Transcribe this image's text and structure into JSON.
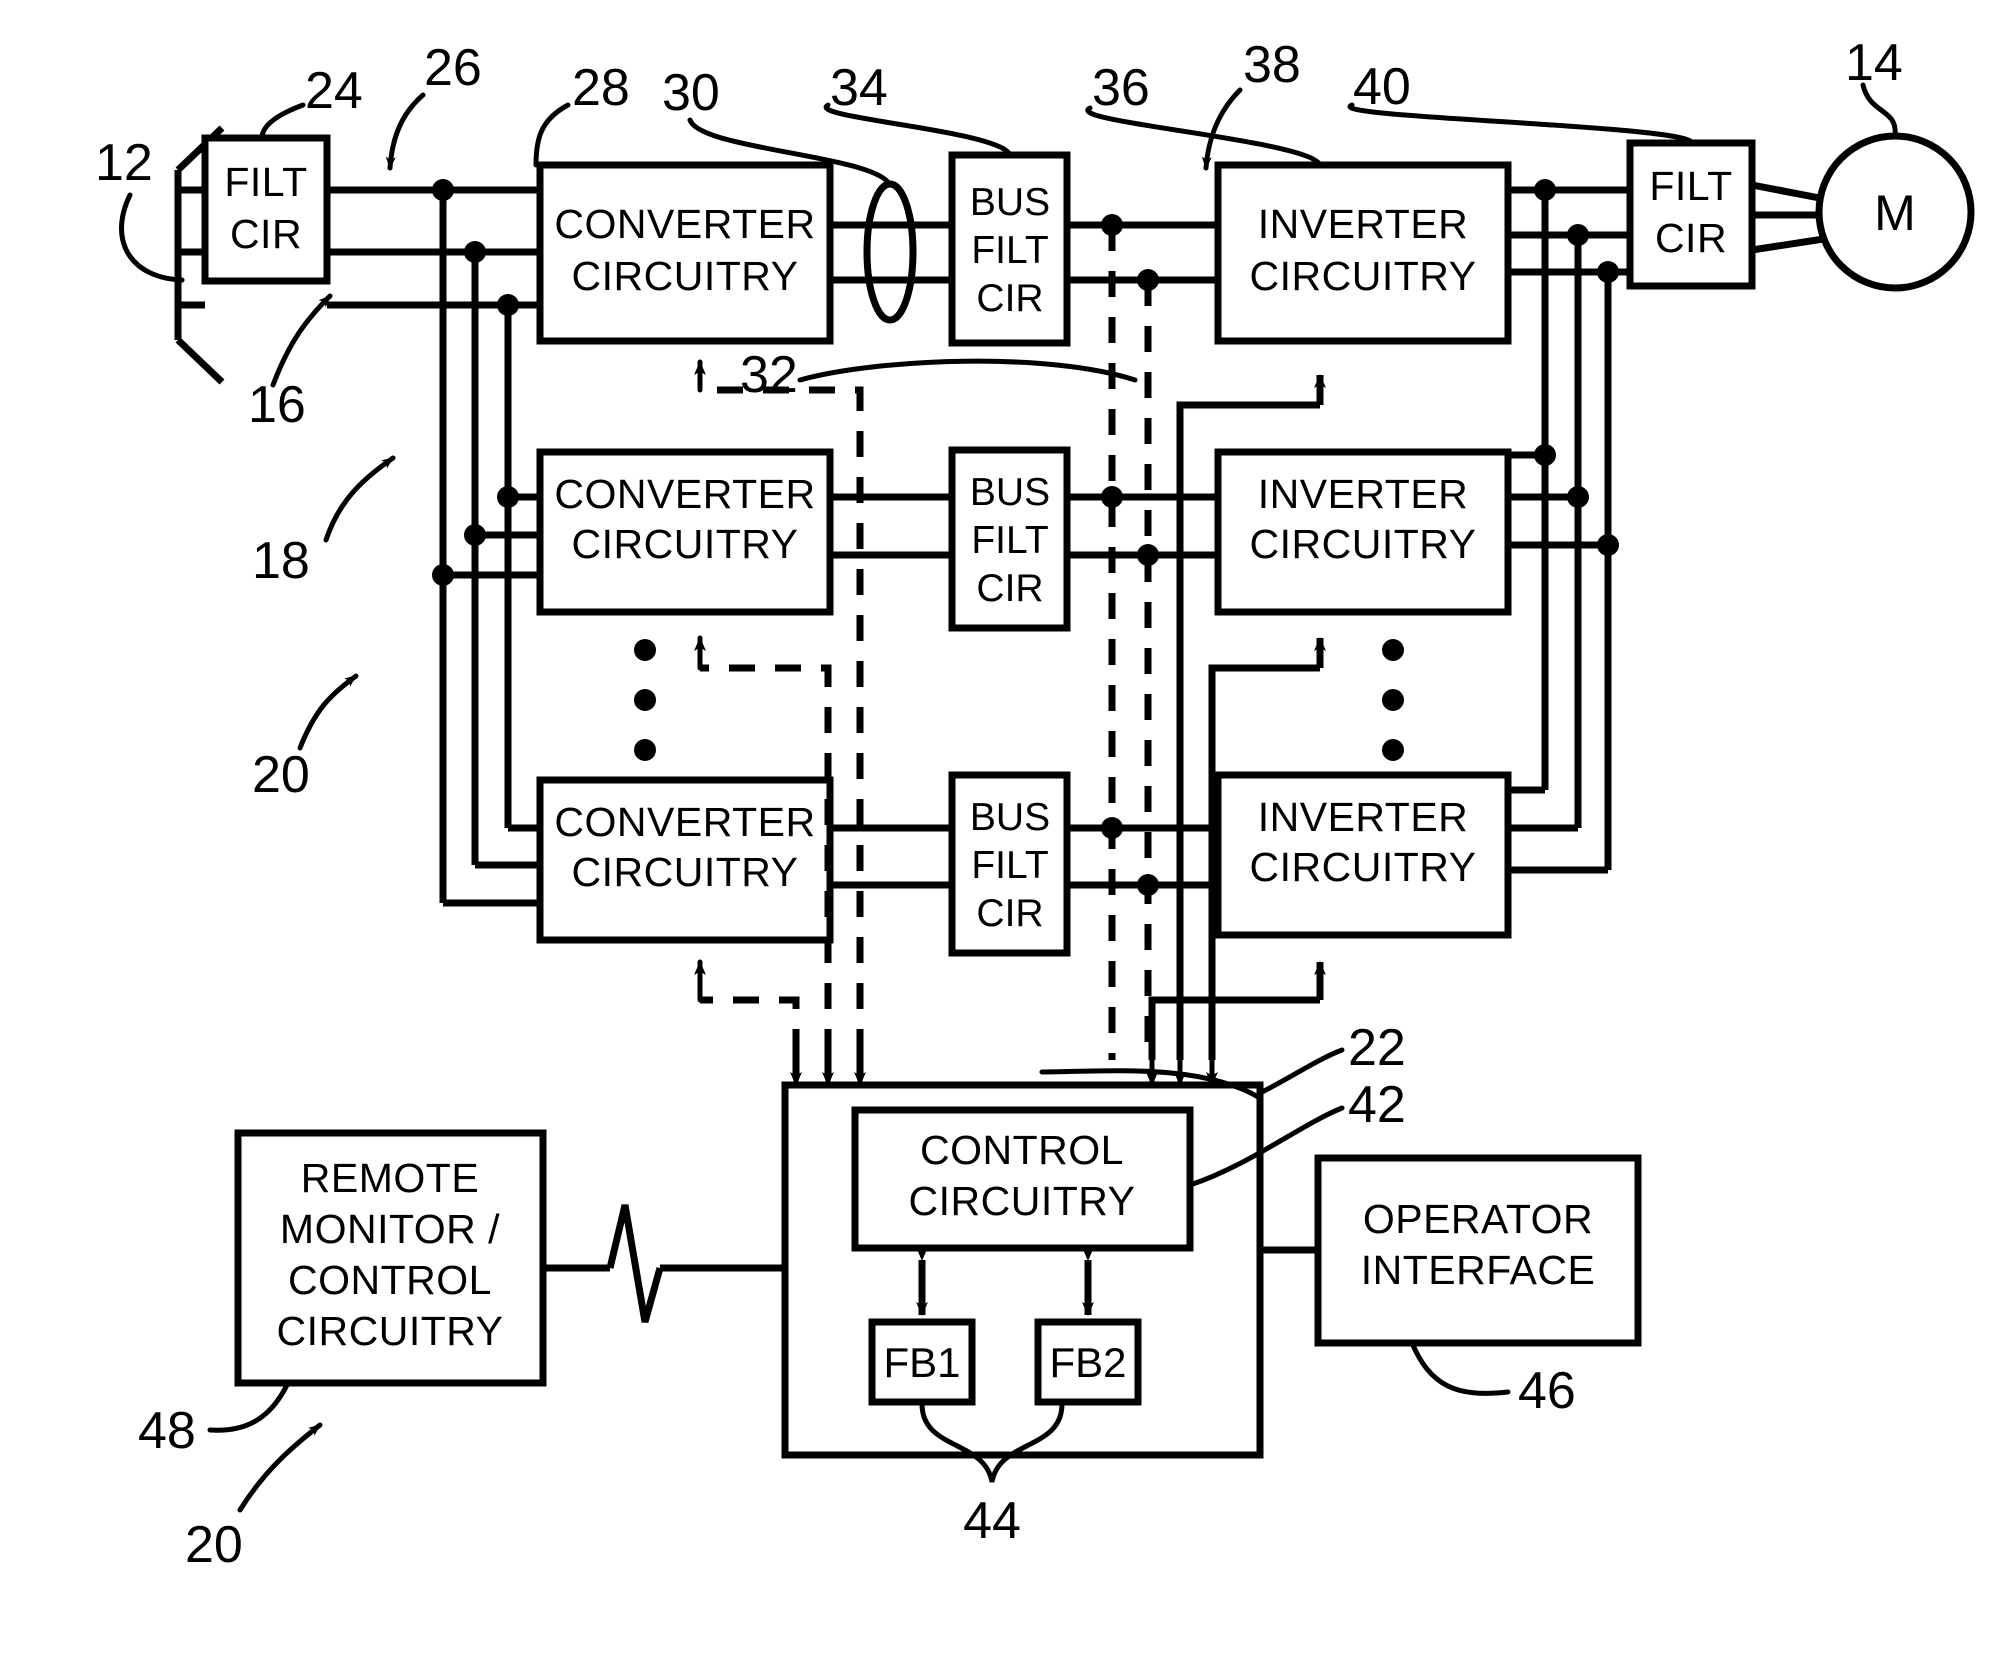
{
  "figure": {
    "type": "patent-block-diagram",
    "description": "Multi-converter / multi-inverter motor drive block diagram"
  },
  "blocks": {
    "input_filter": {
      "line1": "FILT",
      "line2": "CIR",
      "ref": "24"
    },
    "converter_1": {
      "line1": "CONVERTER",
      "line2": "CIRCUITRY",
      "ref": "28"
    },
    "converter_2": {
      "line1": "CONVERTER",
      "line2": "CIRCUITRY"
    },
    "converter_n": {
      "line1": "CONVERTER",
      "line2": "CIRCUITRY"
    },
    "bus_filter_1": {
      "line1": "BUS",
      "line2": "FILT",
      "line3": "CIR",
      "ref": "34"
    },
    "bus_filter_2": {
      "line1": "BUS",
      "line2": "FILT",
      "line3": "CIR"
    },
    "bus_filter_n": {
      "line1": "BUS",
      "line2": "FILT",
      "line3": "CIR"
    },
    "inverter_1": {
      "line1": "INVERTER",
      "line2": "CIRCUITRY",
      "ref": "36"
    },
    "inverter_2": {
      "line1": "INVERTER",
      "line2": "CIRCUITRY"
    },
    "inverter_n": {
      "line1": "INVERTER",
      "line2": "CIRCUITRY"
    },
    "output_filter": {
      "line1": "FILT",
      "line2": "CIR",
      "ref": "40"
    },
    "motor": {
      "label": "M",
      "ref": "14"
    },
    "control_enclosure": {
      "ref": "22"
    },
    "control_circuitry": {
      "line1": "CONTROL",
      "line2": "CIRCUITRY",
      "ref": "42"
    },
    "feedback_1": {
      "label": "FB1"
    },
    "feedback_2": {
      "label": "FB2"
    },
    "feedback_group": {
      "ref": "44"
    },
    "remote_monitor": {
      "line1": "REMOTE",
      "line2": "MONITOR /",
      "line3": "CONTROL",
      "line4": "CIRCUITRY",
      "ref": "48"
    },
    "operator_interface": {
      "line1": "OPERATOR",
      "line2": "INTERFACE",
      "ref": "46"
    }
  },
  "reference_numerals": {
    "n12": "12",
    "n14": "14",
    "n16": "16",
    "n18": "18",
    "n20_top": "20",
    "n20_bottom": "20",
    "n22": "22",
    "n24": "24",
    "n26": "26",
    "n28": "28",
    "n30": "30",
    "n32": "32",
    "n34": "34",
    "n36": "36",
    "n38": "38",
    "n40": "40",
    "n42": "42",
    "n44": "44",
    "n46": "46",
    "n48": "48"
  },
  "colors": {
    "line": "#000000",
    "fill": "#ffffff"
  }
}
